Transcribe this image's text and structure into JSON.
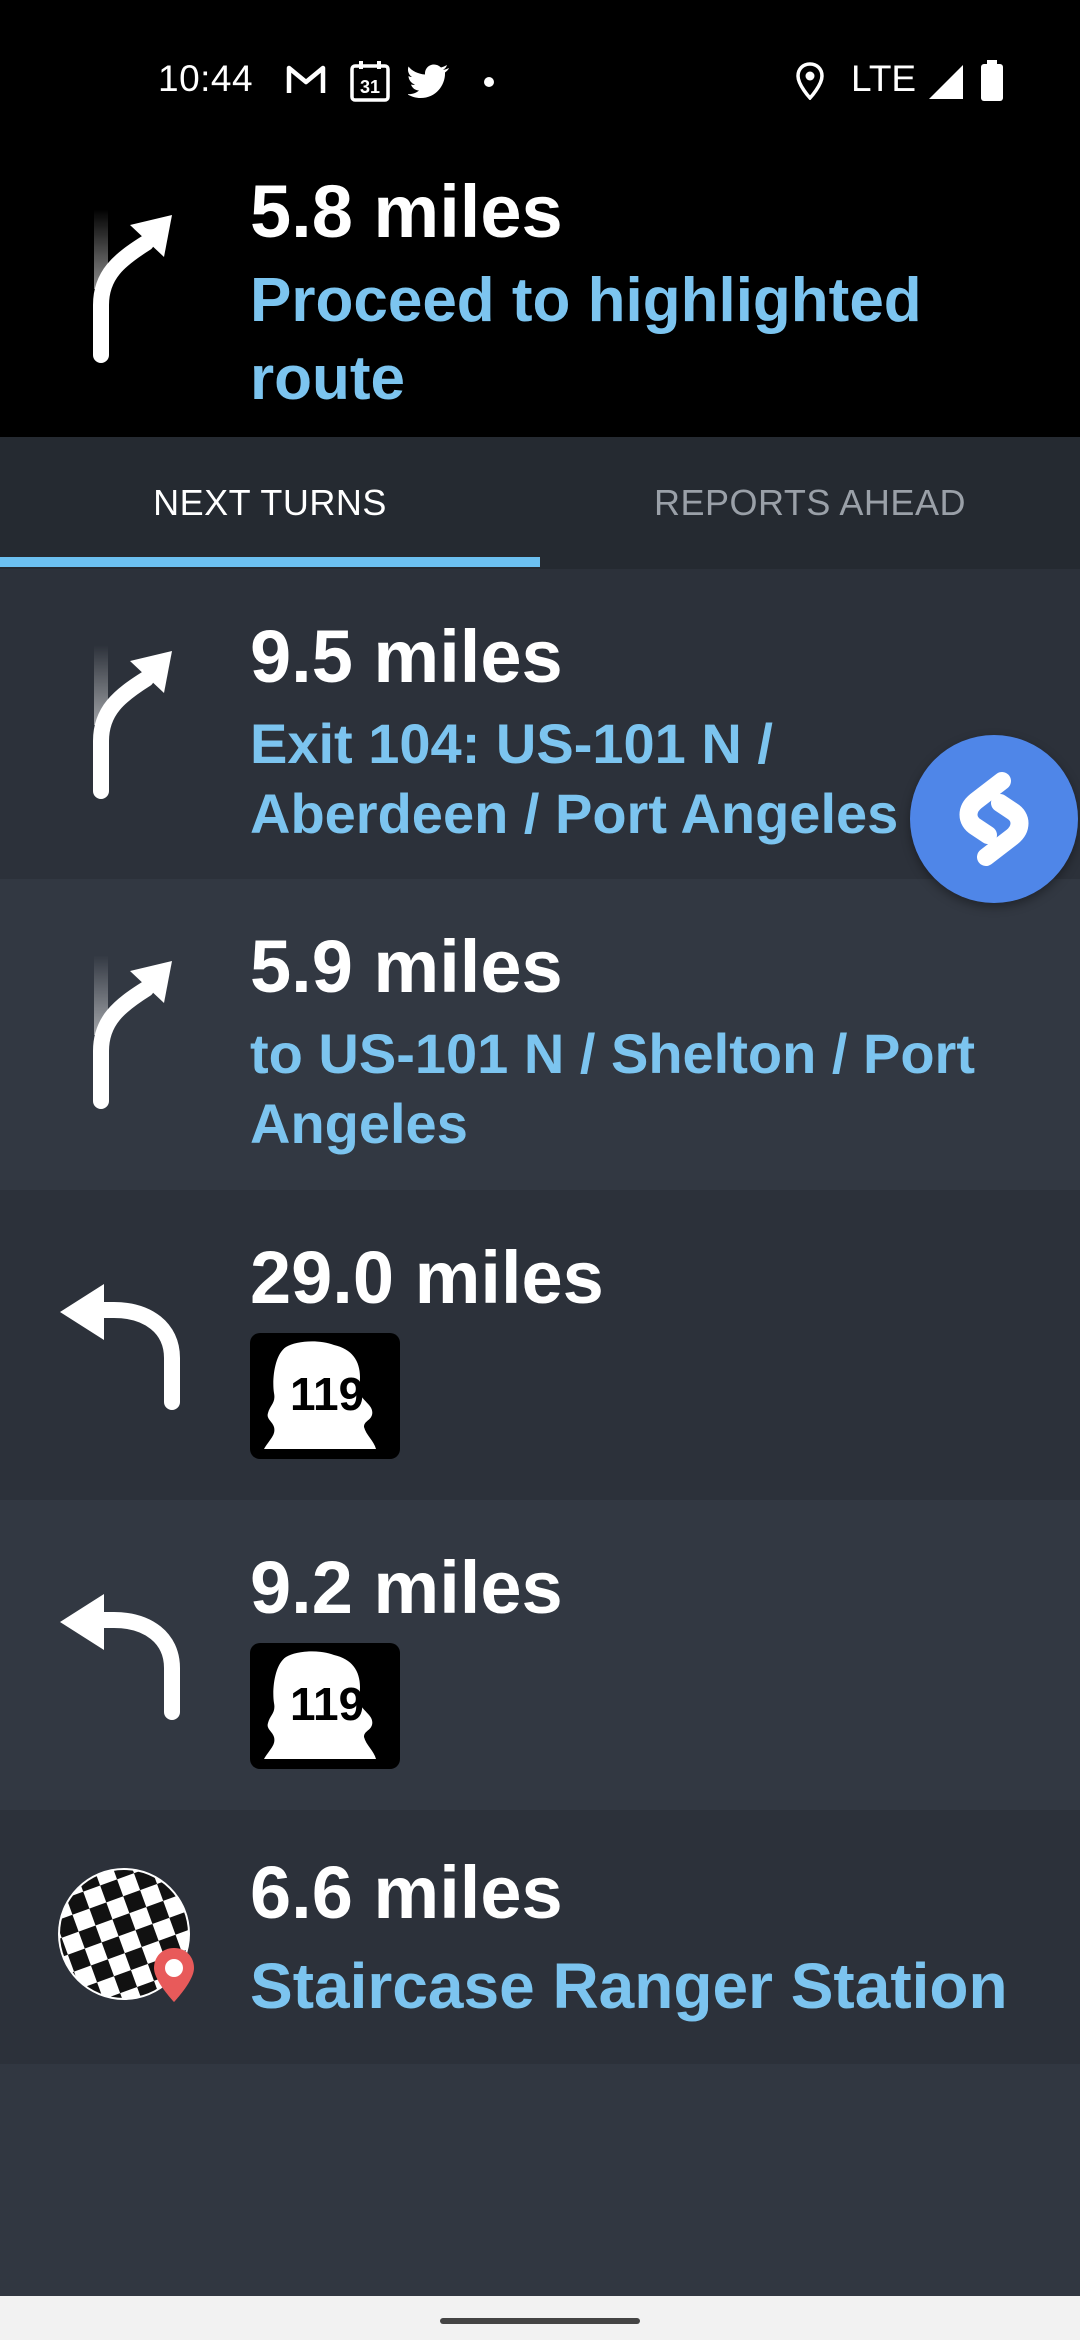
{
  "status_bar": {
    "time": "10:44",
    "calendar_day": "31",
    "network": "LTE",
    "icons": [
      "gmail-icon",
      "calendar-icon",
      "twitter-icon",
      "dot-icon",
      "location-icon",
      "signal-icon",
      "battery-icon"
    ]
  },
  "banner": {
    "distance": "5.8 miles",
    "instruction": "Proceed to highlighted route",
    "icon": "slight-right-arrow-icon"
  },
  "tabs": {
    "next_turns": "NEXT TURNS",
    "reports_ahead": "REPORTS AHEAD",
    "active": "next_turns"
  },
  "turns": [
    {
      "distance": "9.5 miles",
      "description": "Exit 104: US-101 N / Aberdeen / Port Angeles",
      "icon": "slight-right-arrow-icon"
    },
    {
      "distance": "5.9 miles",
      "description": "to US-101 N / Shelton / Port Angeles",
      "icon": "slight-right-arrow-icon"
    },
    {
      "distance": "29.0 miles",
      "route_shield": "119",
      "icon": "left-turn-arrow-icon"
    },
    {
      "distance": "9.2 miles",
      "route_shield": "119",
      "icon": "left-turn-arrow-icon"
    },
    {
      "distance": "6.6 miles",
      "description": "Staircase Ranger Station",
      "icon": "destination-flag-icon"
    }
  ],
  "colors": {
    "accent_blue": "#7cc4ef",
    "tab_indicator": "#6cc0f0",
    "fab": "#4f86e8",
    "pin": "#e85a5a"
  },
  "floating_button": {
    "icon": "shazam-icon"
  }
}
